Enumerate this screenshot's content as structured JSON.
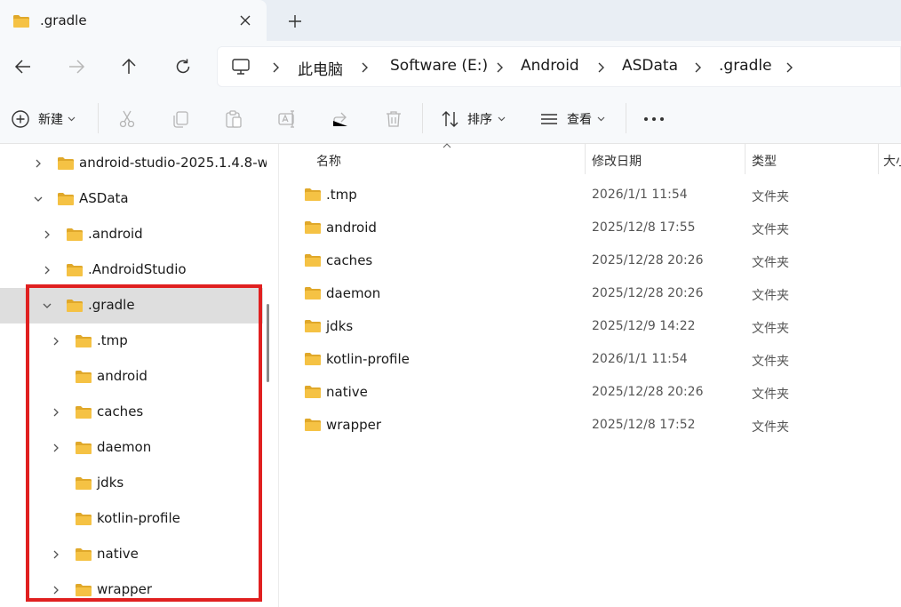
{
  "tab": {
    "title": ".gradle"
  },
  "breadcrumb": [
    "此电脑",
    "Software (E:)",
    "Android",
    "ASData",
    ".gradle"
  ],
  "commandbar": {
    "new_label": "新建",
    "sort_label": "排序",
    "view_label": "查看"
  },
  "navpane": {
    "items": [
      {
        "label": "android-studio-2025.1.4.8-w",
        "expander": "collapsed"
      },
      {
        "label": "ASData",
        "expander": "expanded"
      },
      {
        "label": ".android",
        "expander": "collapsed"
      },
      {
        "label": ".AndroidStudio",
        "expander": "collapsed"
      },
      {
        "label": ".gradle",
        "expander": "expanded",
        "selected": true
      },
      {
        "label": ".tmp",
        "expander": "collapsed"
      },
      {
        "label": "android",
        "expander": "none"
      },
      {
        "label": "caches",
        "expander": "collapsed"
      },
      {
        "label": "daemon",
        "expander": "collapsed"
      },
      {
        "label": "jdks",
        "expander": "none"
      },
      {
        "label": "kotlin-profile",
        "expander": "none"
      },
      {
        "label": "native",
        "expander": "collapsed"
      },
      {
        "label": "wrapper",
        "expander": "collapsed"
      }
    ]
  },
  "columns": {
    "name": "名称",
    "date": "修改日期",
    "type": "类型",
    "size": "大小"
  },
  "files": [
    {
      "name": ".tmp",
      "date": "2026/1/1 11:54",
      "type": "文件夹"
    },
    {
      "name": "android",
      "date": "2025/12/8 17:55",
      "type": "文件夹"
    },
    {
      "name": "caches",
      "date": "2025/12/28 20:26",
      "type": "文件夹"
    },
    {
      "name": "daemon",
      "date": "2025/12/28 20:26",
      "type": "文件夹"
    },
    {
      "name": "jdks",
      "date": "2025/12/9 14:22",
      "type": "文件夹"
    },
    {
      "name": "kotlin-profile",
      "date": "2026/1/1 11:54",
      "type": "文件夹"
    },
    {
      "name": "native",
      "date": "2025/12/28 20:26",
      "type": "文件夹"
    },
    {
      "name": "wrapper",
      "date": "2025/12/8 17:52",
      "type": "文件夹"
    }
  ],
  "colors": {
    "folder": "#f5c244",
    "folder_dark": "#e0a82a",
    "selection": "#dedede",
    "highlight": "#e02020"
  }
}
